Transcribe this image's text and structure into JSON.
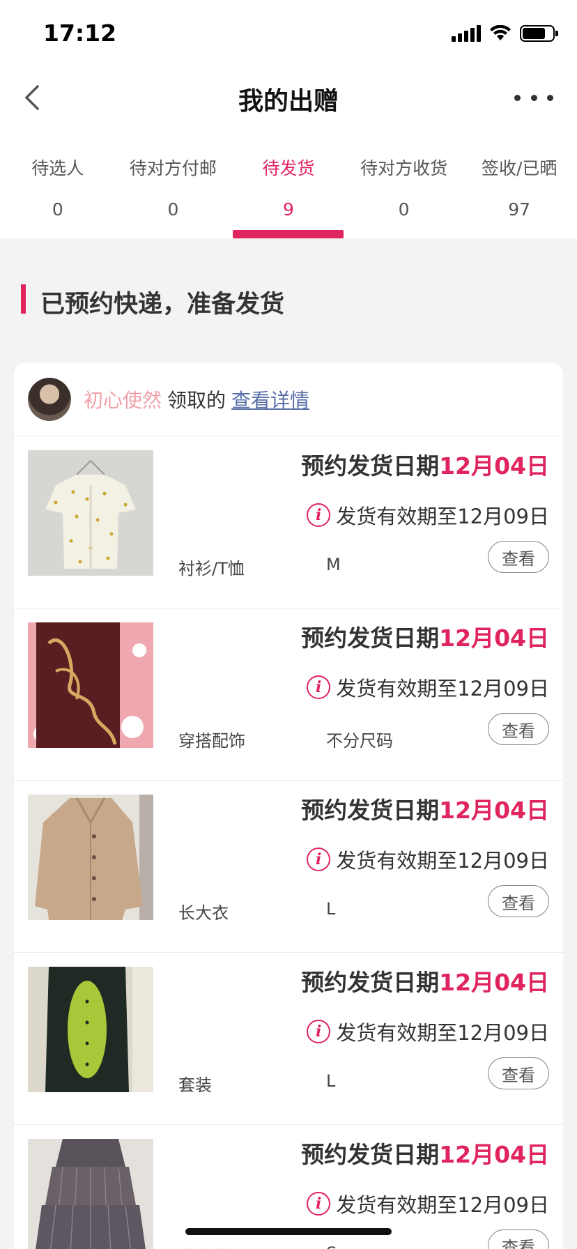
{
  "status_bar": {
    "time": "17:12"
  },
  "nav": {
    "title": "我的出赠"
  },
  "tabs": [
    {
      "label": "待选人",
      "count": "0"
    },
    {
      "label": "待对方付邮",
      "count": "0"
    },
    {
      "label": "待发货",
      "count": "9",
      "active": true
    },
    {
      "label": "待对方收货",
      "count": "0"
    },
    {
      "label": "签收/已晒",
      "count": "97"
    }
  ],
  "section": {
    "title": "已预约快递，准备发货"
  },
  "receiver": {
    "name": "初心使然",
    "action": "领取的",
    "detail_link": "查看详情"
  },
  "items": [
    {
      "ship_label": "预约发货日期",
      "ship_date": "12月04日",
      "valid_text": "发货有效期至12月09日",
      "category": "衬衫/T恤",
      "size": "M",
      "view_label": "查看",
      "image": "white-floral-blouse"
    },
    {
      "ship_label": "预约发货日期",
      "ship_date": "12月04日",
      "valid_text": "发货有效期至12月09日",
      "category": "穿搭配饰",
      "size": "不分尺码",
      "view_label": "查看",
      "image": "naughty-palette"
    },
    {
      "ship_label": "预约发货日期",
      "ship_date": "12月04日",
      "valid_text": "发货有效期至12月09日",
      "category": "长大衣",
      "size": "L",
      "view_label": "查看",
      "image": "beige-long-coat"
    },
    {
      "ship_label": "预约发货日期",
      "ship_date": "12月04日",
      "valid_text": "发货有效期至12月09日",
      "category": "套装",
      "size": "L",
      "view_label": "查看",
      "image": "dinosaur-onesie"
    },
    {
      "ship_label": "预约发货日期",
      "ship_date": "12月04日",
      "valid_text": "发货有效期至12月09日",
      "category": "直连衣裙",
      "size": "S",
      "view_label": "查看",
      "image": "gray-tiered-dress"
    }
  ],
  "colors": {
    "accent": "#e0245e",
    "link": "#5a6fa8",
    "receiver_name": "#f0a0a8"
  }
}
